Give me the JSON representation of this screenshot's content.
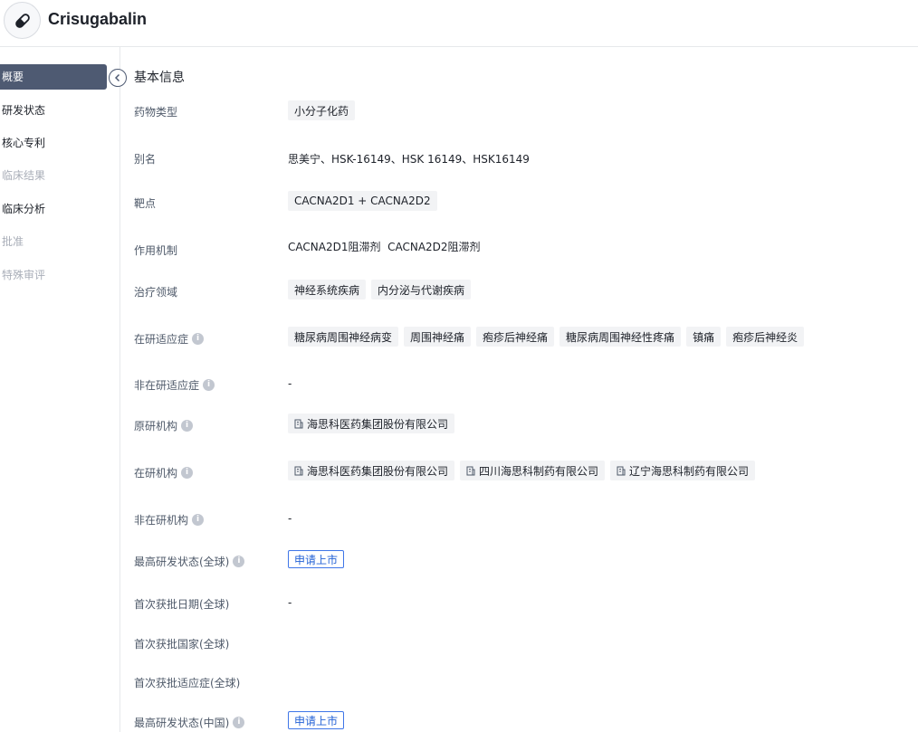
{
  "header": {
    "title": "Crisugabalin",
    "logo_icon": "pill-icon"
  },
  "sidebar": {
    "items": [
      {
        "label": "概要",
        "state": "active"
      },
      {
        "label": "研发状态",
        "state": "normal"
      },
      {
        "label": "核心专利",
        "state": "normal"
      },
      {
        "label": "临床结果",
        "state": "disabled"
      },
      {
        "label": "临床分析",
        "state": "normal"
      },
      {
        "label": "批准",
        "state": "disabled"
      },
      {
        "label": "特殊审评",
        "state": "disabled"
      }
    ],
    "collapse_icon": "chevron-left-icon"
  },
  "section": {
    "title": "基本信息"
  },
  "rows": {
    "drug_type": {
      "label": "药物类型",
      "tags": [
        "小分子化药"
      ]
    },
    "alias": {
      "label": "别名",
      "text": "思美宁、HSK-16149、HSK 16149、HSK16149"
    },
    "target": {
      "label": "靶点",
      "tags": [
        "CACNA2D1 + CACNA2D2"
      ]
    },
    "mechanism": {
      "label": "作用机制",
      "text": "CACNA2D1阻滞剂  CACNA2D2阻滞剂"
    },
    "therapeutic_area": {
      "label": "治疗领域",
      "tags": [
        "神经系统疾病",
        "内分泌与代谢疾病"
      ]
    },
    "active_indication": {
      "label": "在研适应症",
      "tags": [
        "糖尿病周围神经病变",
        "周围神经痛",
        "疱疹后神经痛",
        "糖尿病周围神经性疼痛",
        "镇痛",
        "疱疹后神经炎"
      ]
    },
    "inactive_indication": {
      "label": "非在研适应症",
      "text": "-"
    },
    "originator": {
      "label": "原研机构",
      "orgs": [
        "海思科医药集团股份有限公司"
      ]
    },
    "active_org": {
      "label": "在研机构",
      "orgs": [
        "海思科医药集团股份有限公司",
        "四川海思科制药有限公司",
        "辽宁海思科制药有限公司"
      ]
    },
    "inactive_org": {
      "label": "非在研机构",
      "text": "-"
    },
    "highest_global": {
      "label": "最高研发状态(全球)",
      "status": "申请上市"
    },
    "first_approval_date": {
      "label": "首次获批日期(全球)",
      "text": "-"
    },
    "first_approval_country": {
      "label": "首次获批国家(全球)",
      "text": ""
    },
    "first_approval_indication": {
      "label": "首次获批适应症(全球)",
      "text": ""
    },
    "highest_china": {
      "label": "最高研发状态(中国)",
      "status": "申请上市"
    }
  },
  "colors": {
    "active_nav_bg": "#4e5a72",
    "status_blue": "#2563d6",
    "tag_bg": "#f2f3f5"
  }
}
